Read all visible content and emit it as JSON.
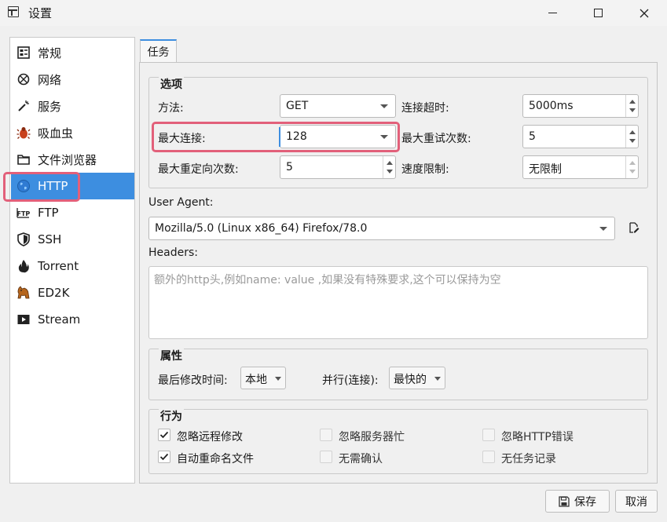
{
  "window": {
    "title": "设置"
  },
  "sidebar": {
    "items": [
      {
        "label": "常规",
        "icon": "general-icon"
      },
      {
        "label": "网络",
        "icon": "network-icon"
      },
      {
        "label": "服务",
        "icon": "wand-icon"
      },
      {
        "label": "吸血虫",
        "icon": "bug-icon"
      },
      {
        "label": "文件浏览器",
        "icon": "folder-icon"
      },
      {
        "label": "HTTP",
        "icon": "globe-icon",
        "active": true
      },
      {
        "label": "FTP",
        "icon": "ftp-icon"
      },
      {
        "label": "SSH",
        "icon": "shield-icon"
      },
      {
        "label": "Torrent",
        "icon": "flame-icon"
      },
      {
        "label": "ED2K",
        "icon": "donkey-icon"
      },
      {
        "label": "Stream",
        "icon": "stream-icon"
      }
    ]
  },
  "tab": {
    "label": "任务"
  },
  "options": {
    "title": "选项",
    "method_label": "方法:",
    "method_value": "GET",
    "timeout_label": "连接超时:",
    "timeout_value": "5000ms",
    "max_conn_label": "最大连接:",
    "max_conn_value": "128",
    "max_retry_label": "最大重试次数:",
    "max_retry_value": "5",
    "max_redirect_label": "最大重定向次数:",
    "max_redirect_value": "5",
    "speed_label": "速度限制:",
    "speed_value": "无限制"
  },
  "user_agent": {
    "label": "User Agent:",
    "value": "Mozilla/5.0 (Linux x86_64) Firefox/78.0"
  },
  "headers": {
    "label": "Headers:",
    "placeholder": "额外的http头,例如name: value ,如果没有特殊要求,这个可以保持为空"
  },
  "properties": {
    "title": "属性",
    "modified_label": "最后修改时间:",
    "modified_value": "本地",
    "parallel_label": "并行(连接):",
    "parallel_value": "最快的"
  },
  "behavior": {
    "title": "行为",
    "checks": [
      {
        "label": "忽略远程修改",
        "checked": true,
        "enabled": true
      },
      {
        "label": "忽略服务器忙",
        "checked": false,
        "enabled": false
      },
      {
        "label": "忽略HTTP错误",
        "checked": false,
        "enabled": false
      },
      {
        "label": "自动重命名文件",
        "checked": true,
        "enabled": true
      },
      {
        "label": "无需确认",
        "checked": false,
        "enabled": false
      },
      {
        "label": "无任务记录",
        "checked": false,
        "enabled": false
      }
    ]
  },
  "footer": {
    "save_label": "保存",
    "cancel_label": "取消"
  },
  "colors": {
    "accent": "#3d8ee0",
    "highlight": "#e2607a"
  }
}
